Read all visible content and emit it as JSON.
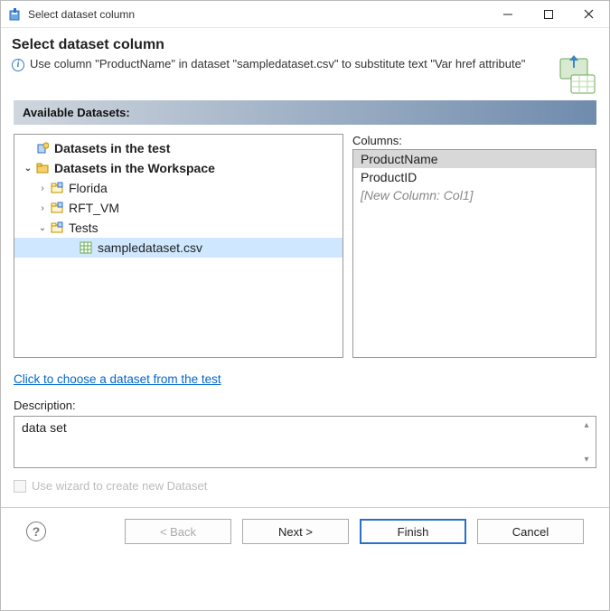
{
  "window": {
    "title": "Select dataset column"
  },
  "header": {
    "title": "Select dataset column",
    "info": "Use column \"ProductName\" in dataset \"sampledataset.csv\" to substitute text \"Var href attribute\""
  },
  "section_label": "Available Datasets:",
  "tree": {
    "root_test_label": "Datasets in the test",
    "root_workspace_label": "Datasets in the Workspace",
    "nodes": {
      "florida": "Florida",
      "rft_vm": "RFT_VM",
      "tests": "Tests",
      "sample": "sampledataset.csv"
    }
  },
  "columns": {
    "label": "Columns:",
    "items": [
      {
        "name": "ProductName",
        "selected": true
      },
      {
        "name": "ProductID",
        "selected": false
      }
    ],
    "placeholder": "[New Column: Col1]"
  },
  "choose_link": "Click to choose a dataset from the test",
  "description": {
    "label": "Description:",
    "value": "data set"
  },
  "wizard_checkbox_label": "Use wizard to create new Dataset",
  "buttons": {
    "back": "< Back",
    "next": "Next >",
    "finish": "Finish",
    "cancel": "Cancel"
  }
}
